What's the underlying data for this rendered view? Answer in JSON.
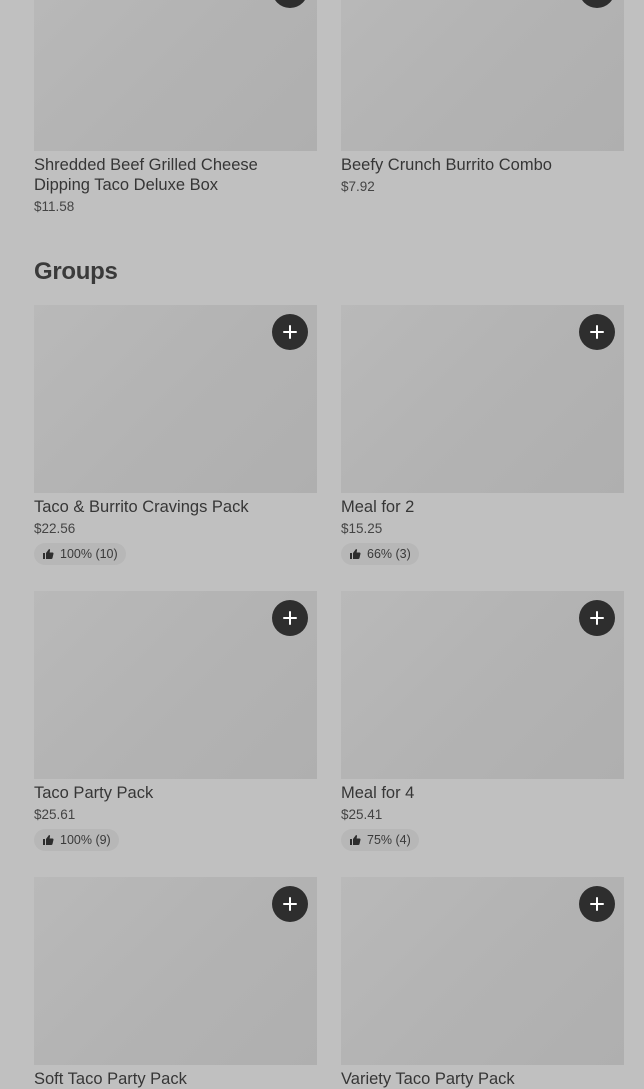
{
  "top_items": [
    {
      "name": "Shredded Beef Grilled Cheese Dipping Taco Deluxe Box",
      "price": "$11.58"
    },
    {
      "name": "Beefy Crunch Burrito Combo",
      "price": "$7.92"
    }
  ],
  "groups_section": {
    "title": "Groups",
    "items": [
      {
        "name": "Taco & Burrito Cravings Pack",
        "price": "$22.56",
        "rating": "100% (10)"
      },
      {
        "name": "Meal for 2",
        "price": "$15.25",
        "rating": "66% (3)"
      },
      {
        "name": "Taco Party Pack",
        "price": "$25.61",
        "rating": "100% (9)"
      },
      {
        "name": "Meal for 4",
        "price": "$25.41",
        "rating": "75% (4)"
      },
      {
        "name": "Soft Taco Party Pack"
      },
      {
        "name": "Variety Taco Party Pack"
      }
    ]
  },
  "icons": {
    "add": "plus-icon",
    "rating": "thumbs-up-icon"
  }
}
